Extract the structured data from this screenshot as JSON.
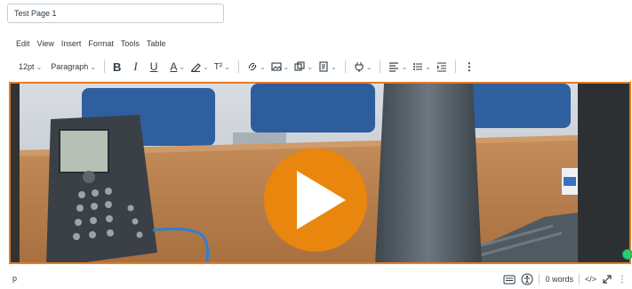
{
  "page_title_input": {
    "value": "Test Page 1"
  },
  "menubar": {
    "items": [
      "Edit",
      "View",
      "Insert",
      "Format",
      "Tools",
      "Table"
    ]
  },
  "toolbar": {
    "font_size": "12pt",
    "block_format": "Paragraph",
    "bold": "B",
    "italic": "I",
    "underline": "U",
    "text_color": "A",
    "superscript": "T²"
  },
  "statusbar": {
    "path": "p",
    "word_count": "0 words",
    "html_toggle": "</>"
  },
  "colors": {
    "accent": "#e27d28",
    "play_button": "#e8860e"
  }
}
